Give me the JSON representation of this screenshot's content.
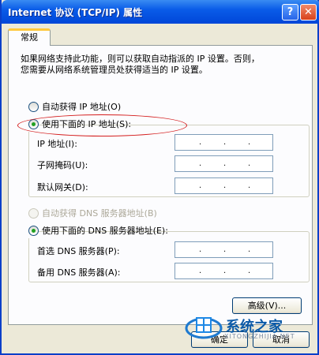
{
  "window": {
    "title": "Internet 协议 (TCP/IP) 属性",
    "help_glyph": "?",
    "close_glyph": "✕"
  },
  "tabs": [
    {
      "label": "常规"
    }
  ],
  "description": {
    "line1": "如果网络支持此功能，则可以获取自动指派的 IP 设置。否则，",
    "line2": "您需要从网络系统管理员处获得适当的 IP 设置。"
  },
  "ip_options": {
    "auto_label": "自动获得 IP 地址(O)",
    "manual_label": "使用下面的 IP 地址(S):",
    "selected": "manual"
  },
  "ip_fields": [
    {
      "label": "IP 地址(I):",
      "value": ". . ."
    },
    {
      "label": "子网掩码(U):",
      "value": ". . ."
    },
    {
      "label": "默认网关(D):",
      "value": ". . ."
    }
  ],
  "dns_options": {
    "auto_label": "自动获得 DNS 服务器地址(B)",
    "manual_label": "使用下面的 DNS 服务器地址(E):",
    "selected": "manual"
  },
  "dns_fields": [
    {
      "label": "首选 DNS 服务器(P):",
      "value": ". . ."
    },
    {
      "label": "备用 DNS 服务器(A):",
      "value": ". . ."
    }
  ],
  "buttons": {
    "advanced": "高级(V)...",
    "ok": "确定",
    "cancel": "取消"
  },
  "watermark": {
    "text": "系统之家",
    "sub": "XITONGZHIJIA.NET"
  },
  "colors": {
    "title_bar": "#0a5ce8",
    "highlight_ellipse": "#d41d1d",
    "tab_accent": "#ffc83c"
  }
}
